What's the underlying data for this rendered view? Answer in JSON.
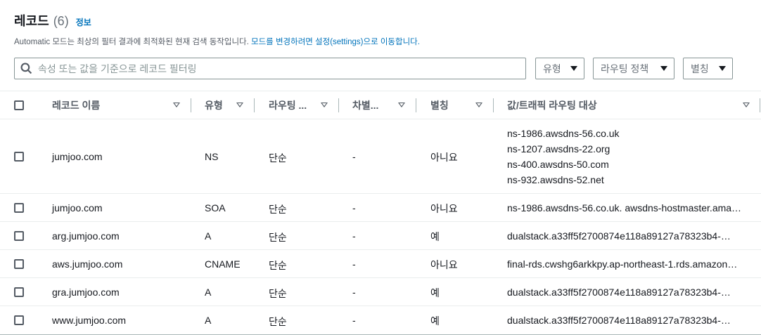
{
  "header": {
    "title": "레코드",
    "count": "(6)",
    "info_link": "정보"
  },
  "description": {
    "text": "Automatic 모드는 최상의 필터 결과에 최적화된 현재 검색 동작입니다.",
    "link": "모드를 변경하려면 설정(settings)으로 이동합니다."
  },
  "search": {
    "placeholder": "속성 또는 값을 기준으로 레코드 필터링"
  },
  "filters": {
    "type": "유형",
    "routing_policy": "라우팅 정책",
    "alias": "별칭"
  },
  "table": {
    "columns": {
      "name": "레코드 이름",
      "type": "유형",
      "routing": "라우팅 ...",
      "differentiator": "차별...",
      "alias": "별칭",
      "value": "값/트래픽 라우팅 대상"
    },
    "rows": [
      {
        "name": "jumjoo.com",
        "type": "NS",
        "routing": "단순",
        "differentiator": "-",
        "alias": "아니요",
        "values": [
          "ns-1986.awsdns-56.co.uk",
          "ns-1207.awsdns-22.org",
          "ns-400.awsdns-50.com",
          "ns-932.awsdns-52.net"
        ]
      },
      {
        "name": "jumjoo.com",
        "type": "SOA",
        "routing": "단순",
        "differentiator": "-",
        "alias": "아니요",
        "values": [
          "ns-1986.awsdns-56.co.uk. awsdns-hostmaster.ama…"
        ]
      },
      {
        "name": "arg.jumjoo.com",
        "type": "A",
        "routing": "단순",
        "differentiator": "-",
        "alias": "예",
        "values": [
          "dualstack.a33ff5f2700874e118a89127a78323b4-…"
        ]
      },
      {
        "name": "aws.jumjoo.com",
        "type": "CNAME",
        "routing": "단순",
        "differentiator": "-",
        "alias": "아니요",
        "values": [
          "final-rds.cwshg6arkkpy.ap-northeast-1.rds.amazon…"
        ]
      },
      {
        "name": "gra.jumjoo.com",
        "type": "A",
        "routing": "단순",
        "differentiator": "-",
        "alias": "예",
        "values": [
          "dualstack.a33ff5f2700874e118a89127a78323b4-…"
        ]
      },
      {
        "name": "www.jumjoo.com",
        "type": "A",
        "routing": "단순",
        "differentiator": "-",
        "alias": "예",
        "values": [
          "dualstack.a33ff5f2700874e118a89127a78323b4-…"
        ]
      }
    ]
  },
  "colors": {
    "link": "#0073bb",
    "text": "#16191f",
    "muted": "#545b64",
    "border": "#879596"
  }
}
